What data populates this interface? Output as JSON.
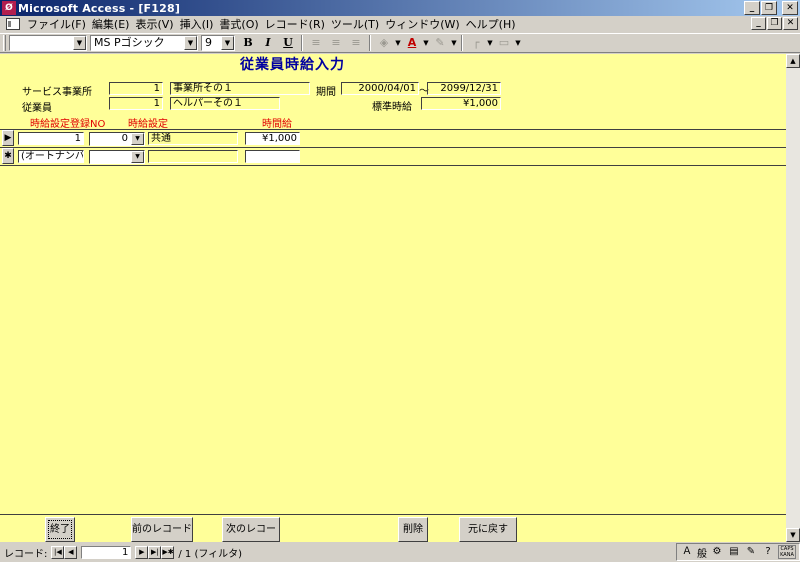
{
  "window": {
    "app_icon": "access-key-icon",
    "title": "Microsoft Access - [F128]",
    "buttons": {
      "minimize": "_",
      "restore": "ð",
      "close": "✕"
    }
  },
  "menu": {
    "items": [
      "ファイル(F)",
      "編集(E)",
      "表示(V)",
      "挿入(I)",
      "書式(O)",
      "レコード(R)",
      "ツール(T)",
      "ウィンドウ(W)",
      "ヘルプ(H)"
    ]
  },
  "toolbar": {
    "object_combo": "",
    "font_combo": "MS Pゴシック",
    "size_combo": "9",
    "bold": "B",
    "italic": "I",
    "underline": "U"
  },
  "form": {
    "title": "従業員時給入力",
    "header": {
      "office_label": "サービス事業所",
      "office_id": "1",
      "office_name": "事業所その１",
      "period_label": "期間",
      "period_from": "2000/04/01",
      "period_sep": "～",
      "period_to": "2099/12/31",
      "employee_label": "従業員",
      "employee_id": "1",
      "employee_name": "ヘルパーその１",
      "standard_wage_label": "標準時給",
      "standard_wage": "¥1,000"
    },
    "columns": {
      "reg_no": "時給設定登録NO",
      "setting": "時給設定",
      "hourly": "時間給"
    },
    "rows": [
      {
        "selector": "▶",
        "reg_no": "1",
        "setting_code": "0",
        "setting_name": "共通",
        "hourly": "¥1,000"
      },
      {
        "selector": "✱",
        "reg_no": "(オートナンバー)",
        "setting_code": "",
        "setting_name": "",
        "hourly": ""
      }
    ]
  },
  "footer": {
    "close": "終了",
    "prev": "前のレコード",
    "next": "次のレコード",
    "delete": "削除",
    "undo": "元に戻す"
  },
  "navigation": {
    "label": "レコード:",
    "current": "1",
    "total": "/ 1 (フィルタ)"
  },
  "tray": {
    "ime_mode": "般",
    "caps": "CAPS",
    "kana": "KANA"
  }
}
